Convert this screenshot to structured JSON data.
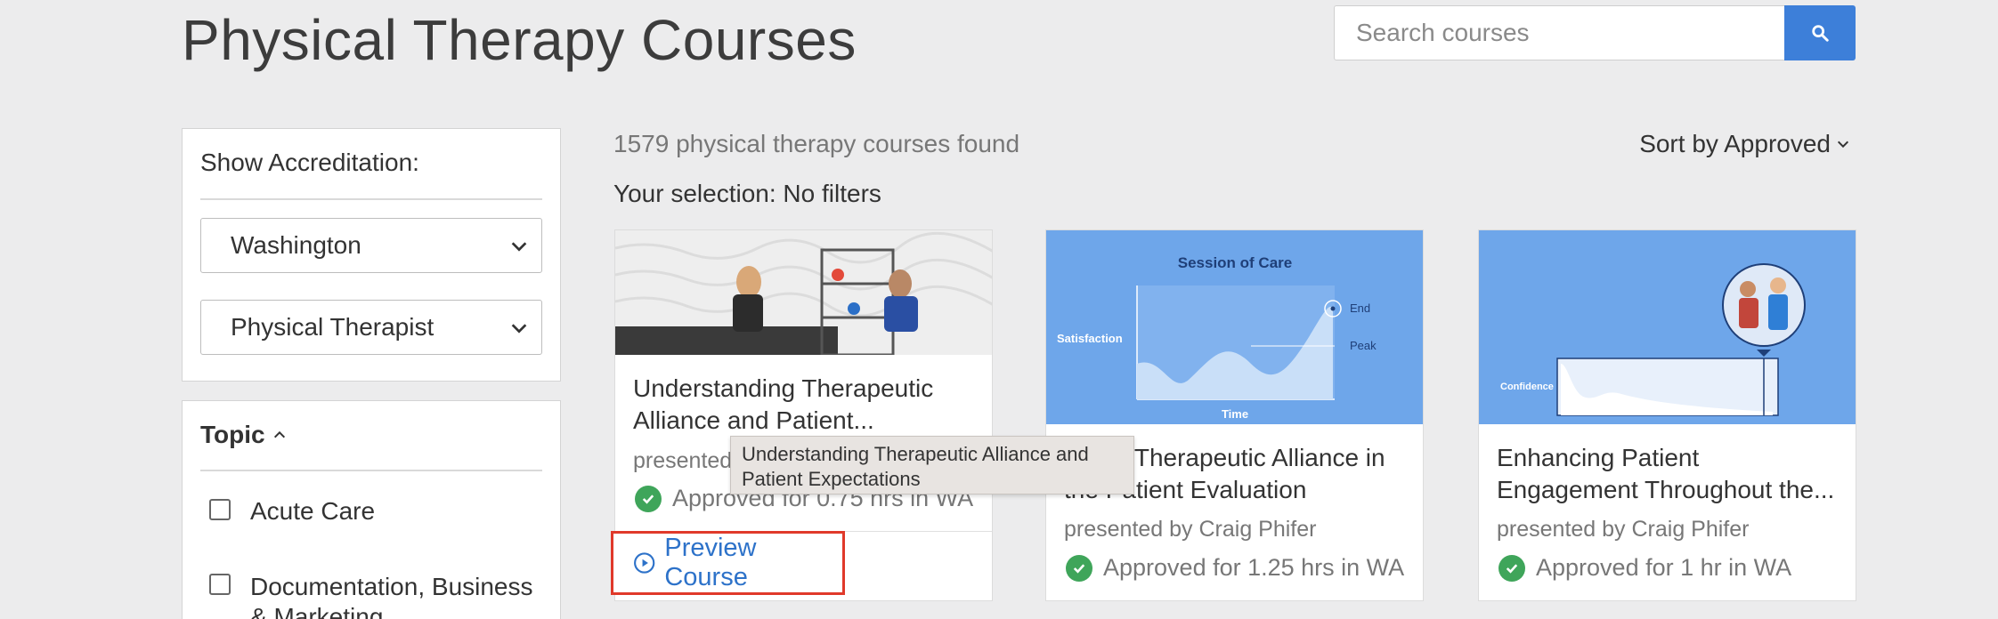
{
  "header": {
    "title": "Physical Therapy Courses",
    "search_placeholder": "Search courses"
  },
  "sidebar": {
    "accreditation_label": "Show Accreditation:",
    "state_select": "Washington",
    "profession_select": "Physical Therapist",
    "topic_title": "Topic",
    "topics": [
      {
        "label": "Acute Care"
      },
      {
        "label": "Documentation, Business & Marketing"
      }
    ]
  },
  "results": {
    "count_text": "1579 physical therapy courses found",
    "selection_text": "Your selection: No filters",
    "sort_label": "Sort by Approved"
  },
  "courses": [
    {
      "title": "Understanding Therapeutic Alliance and Patient...",
      "presenter": "presented by Craig Phifer",
      "approved": "Approved for 0.75 hrs in WA",
      "preview_label": "Preview Course"
    },
    {
      "title": "Using Therapeutic Alliance in the Patient Evaluation",
      "presenter": "presented by Craig Phifer",
      "approved": "Approved for 1.25 hrs in WA",
      "thumb_title": "Session of Care",
      "thumb_ylabel": "Satisfaction",
      "thumb_xlabel": "Time",
      "thumb_end": "End",
      "thumb_peak": "Peak"
    },
    {
      "title": "Enhancing Patient Engagement Throughout the...",
      "presenter": "presented by Craig Phifer",
      "approved": "Approved for 1 hr in WA",
      "thumb_ylabel": "Confidence"
    }
  ],
  "tooltip": {
    "text": "Understanding Therapeutic Alliance and Patient Expectations"
  },
  "colors": {
    "accent": "#3d7fd9",
    "approved_green": "#3fa55a",
    "highlight_red": "#e0392a",
    "link_blue": "#2d72c9"
  }
}
